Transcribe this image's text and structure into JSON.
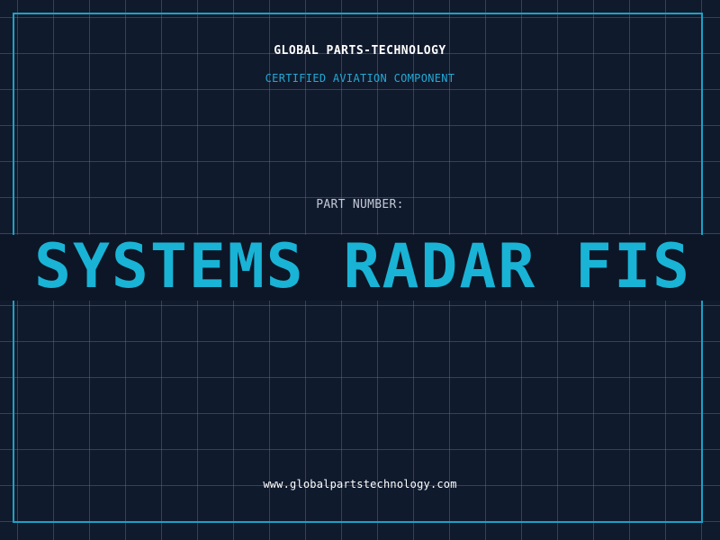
{
  "header": {
    "company": "GLOBAL PARTS-TECHNOLOGY",
    "subtitle": "CERTIFIED AVIATION COMPONENT"
  },
  "part": {
    "label": "PART NUMBER:",
    "value": "SYSTEMS RADAR FIS"
  },
  "footer": {
    "website": "www.globalpartstechnology.com"
  },
  "colors": {
    "background": "#101a2d",
    "grid": "#22768c",
    "frame": "#1ba2c6",
    "accent": "#19b3d6",
    "band": "#0d1626"
  }
}
